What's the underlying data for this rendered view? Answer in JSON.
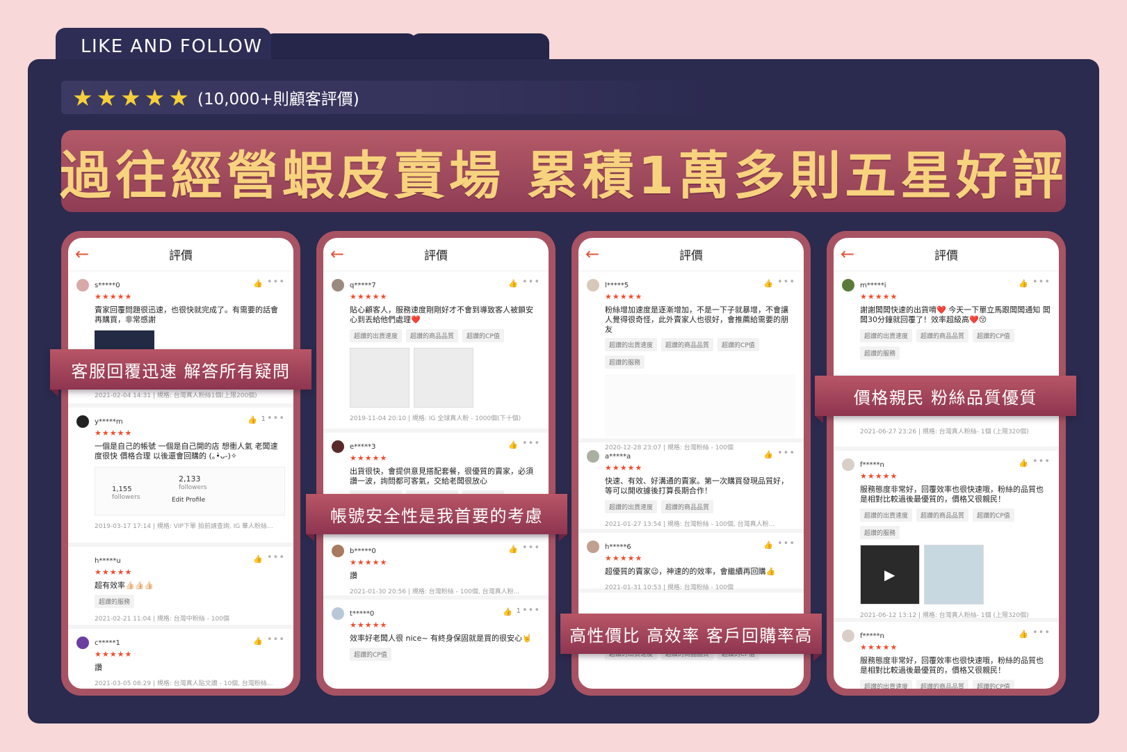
{
  "tab_label": "LIKE AND FOLLOW",
  "rating": {
    "stars": "★★★★★",
    "text": "(10,000+則顧客評價)",
    "star_color": "#f5cf3b"
  },
  "headline": "過往經營蝦皮賣場 累積1萬多則五星好評",
  "colors": {
    "panel": "#2b2a4f",
    "accent": "#a85363",
    "headline_text": "#f7d37e",
    "review_star": "#ee4d2d"
  },
  "banners": [
    "客服回覆迅速 解答所有疑問",
    "帳號安全性是我首要的考慮",
    "高性價比 高效率 客戶回購率高",
    "價格親民 粉絲品質優質"
  ],
  "phones": [
    {
      "title": "評價",
      "reviews": [
        {
          "user": "s*****0",
          "stars": "★★★★★",
          "text": "賣家回覆問題很迅速，也很快就完成了。有需要的話會再購買，非常感謝",
          "meta": "2021-02-04 14:31 | 規格: 台灣真人粉絲1個(上限200個)"
        },
        {
          "user": "y*****m",
          "stars": "★★★★★",
          "likes": "1",
          "text": "一個是自己的帳號 一個是自己開的店 想衝人氣 老闆速度很快 價格合理 以後還會回購的 (｡•̀ᴗ-)✧",
          "stats": [
            "2,133",
            "followers",
            "1,155",
            "followers",
            "Edit Profile"
          ],
          "meta": "2019-03-17 17:14 | 規格: VIP下單 拍前請查詢, IG 華人粉絲..."
        },
        {
          "user": "h*****u",
          "stars": "★★★★★",
          "text": "超有效率👍🏻👍🏻👍🏻",
          "tags": [
            "超讚的服務"
          ],
          "meta": "2021-02-21 11:04 | 規格: 台灣中粉絲 - 100個"
        },
        {
          "user": "c*****1",
          "stars": "★★★★★",
          "text": "讚",
          "meta": "2021-03-05 08:29 | 規格: 台灣真人貼文讚 - 10個, 台灣粉絲..."
        }
      ]
    },
    {
      "title": "評價",
      "reviews": [
        {
          "user": "q*****7",
          "stars": "★★★★★",
          "text": "貼心顧客人，服務速度剛剛好才不會到導致客人被鎖安心到丟給他們處理❤️",
          "tags": [
            "超讚的出貨速度",
            "超讚的商品品質",
            "超讚的CP值"
          ],
          "meta": "2019-11-04 20:10 | 規格: IG 全球真人粉 - 1000個(下十個)"
        },
        {
          "user": "e*****3",
          "stars": "★★★★★",
          "text": "出貨很快，會提供意見搭配套餐，很優質的賣家，必須讚一波，詢問都可客氣，交給老闆很放心",
          "tags": [
            "超讚的出貨速度",
            "超讚的商品品質",
            "超讚的CP值"
          ]
        },
        {
          "user": "b*****0",
          "stars": "★★★★★",
          "text": "讚",
          "meta": "2021-01-30 20:56 | 規格: 台灣粉絲 - 100個, 台灣真人粉..."
        },
        {
          "user": "t*****0",
          "stars": "★★★★★",
          "likes": "1",
          "text": "效率好老闆人很 nice~ 有終身保固就是買的很安心🤘",
          "tags": [
            "超讚的CP值"
          ]
        }
      ]
    },
    {
      "title": "評價",
      "reviews": [
        {
          "user": "l*****5",
          "stars": "★★★★★",
          "text": "粉絲增加速度是逐漸增加，不是一下子就暴增，不會讓人覺得很奇怪，此外賣家人也很好，會推薦給需要的朋友",
          "tags": [
            "超讚的出貨速度",
            "超讚的商品品質",
            "超讚的CP值",
            "超讚的服務"
          ],
          "meta": "2020-12-28 23:07 | 規格: 台灣粉絲 - 100個"
        },
        {
          "user": "a*****a",
          "stars": "★★★★★",
          "text": "快速、有效、好溝通的賣家。第一次購買發現品質好，等可以開收據後打算長期合作！",
          "tags": [
            "超讚的出貨速度",
            "超讚的商品品質"
          ],
          "meta": "2021-01-27 13:54 | 規格: 台灣粉絲 - 100個, 台灣真人粉..."
        },
        {
          "user": "h*****6",
          "stars": "★★★★★",
          "text": "超優質的賣家😉，神速的的效率，會繼續再回購👍",
          "meta": "2021-01-31 10:53 | 規格: 台灣粉絲 - 100個"
        },
        {
          "user": "",
          "stars": "",
          "text": "",
          "tags": [
            "超讚的出貨速度",
            "超讚的商品品質",
            "超讚的CP值"
          ]
        }
      ]
    },
    {
      "title": "評價",
      "reviews": [
        {
          "user": "m*****i",
          "stars": "★★★★★",
          "text": "謝謝闆闆快速的出貨唷❤️ 今天一下單立馬跟闆闆通知 闆闆30分鐘就回覆了！效率超級高❤️😚",
          "tags": [
            "超讚的出貨速度",
            "超讚的商品品質",
            "超讚的CP值",
            "超讚的服務"
          ],
          "meta": "2021-06-27 23:26 | 規格: 台灣真人粉絲- 1個 (上限320個)"
        },
        {
          "user": "f*****n",
          "stars": "★★★★★",
          "text": "服務態度非常好，回覆效率也很快速哦，粉絲的品質也是相對比較過後最優質的，價格又很親民！",
          "tags": [
            "超讚的出貨速度",
            "超讚的商品品質",
            "超讚的CP值",
            "超讚的服務"
          ],
          "meta": "2021-06-12 13:12 | 規格: 台灣真人粉絲- 1個 (上限320個)"
        },
        {
          "user": "f*****n",
          "stars": "★★★★★",
          "text": "服務態度非常好，回覆效率也很快速哦，粉絲的品質也是相對比較過後最優質的，價格又很親民！",
          "tags": [
            "超讚的出貨速度",
            "超讚的商品品質",
            "超讚的CP值"
          ]
        }
      ]
    }
  ]
}
